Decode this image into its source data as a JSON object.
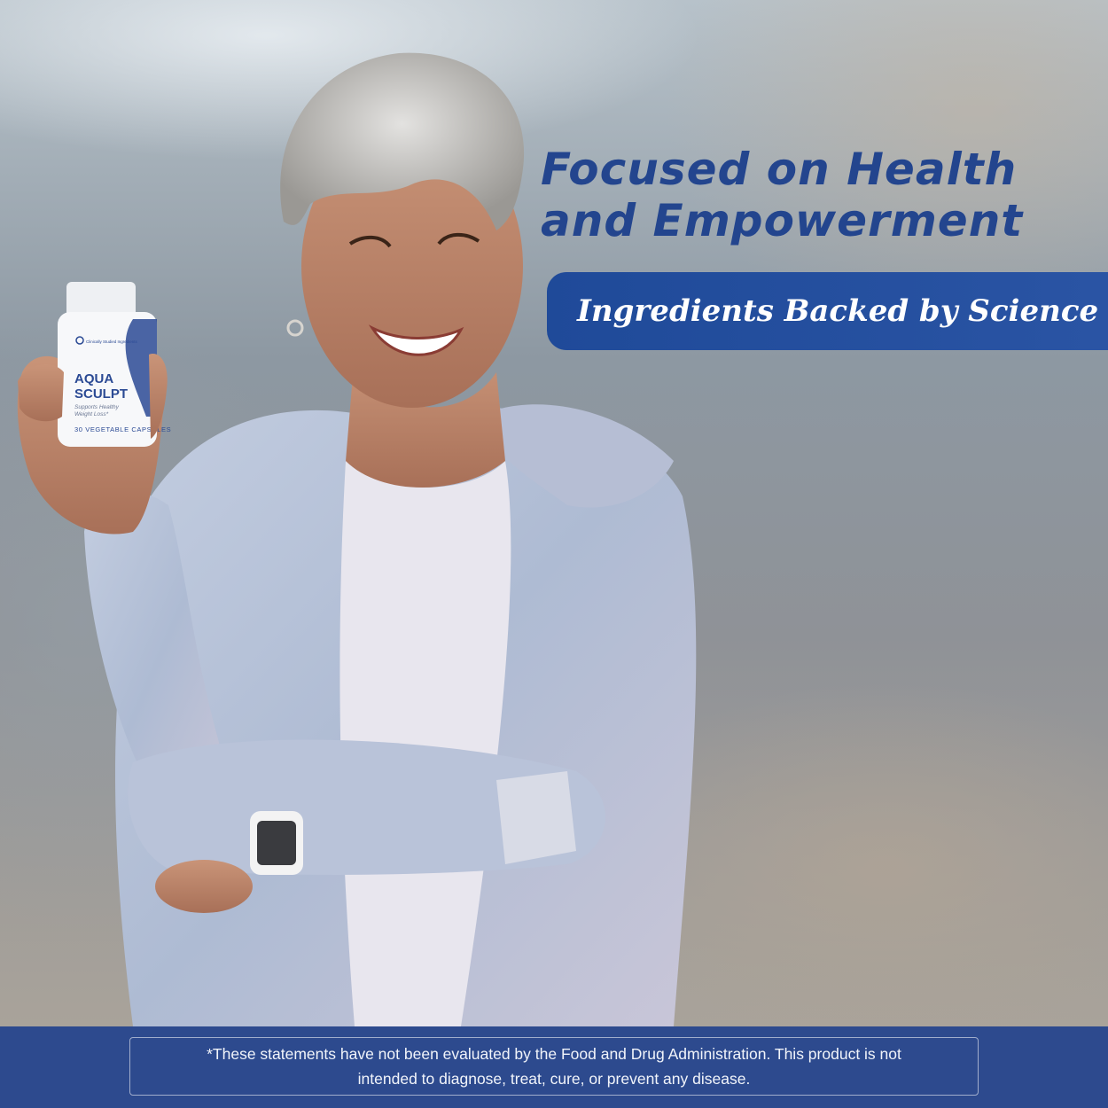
{
  "headline": {
    "line1": "Focused on Health",
    "line2": "and Empowerment"
  },
  "banner": {
    "text": "Ingredients Backed by Science"
  },
  "product": {
    "badge": "Clinically Studied Ingredients",
    "brand_line1": "AQUA",
    "brand_line2": "SCULPT",
    "tagline_line1": "Supports Healthy",
    "tagline_line2": "Weight Loss*",
    "count": "30 VEGETABLE CAPSULES",
    "brand_color": "#2b4a94"
  },
  "disclaimer": {
    "line1": "*These statements have not been evaluated by the Food and Drug Administration. This product is not",
    "line2": "intended to diagnose, treat, cure, or prevent any disease."
  },
  "colors": {
    "headline": "#23458e",
    "banner": "#1f4a99",
    "footer": "#2d4a8e"
  }
}
